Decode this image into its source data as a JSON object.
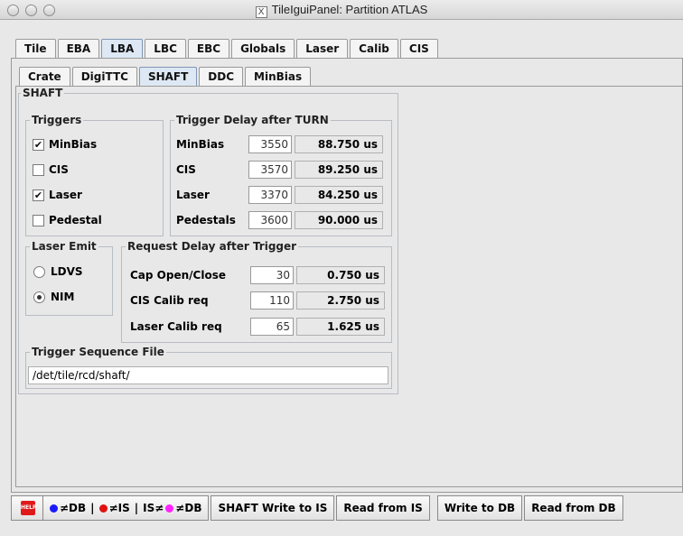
{
  "window": {
    "title": "TileIguiPanel: Partition ATLAS",
    "title_icon": "X"
  },
  "main_tabs": [
    "Tile",
    "EBA",
    "LBA",
    "LBC",
    "EBC",
    "Globals",
    "Laser",
    "Calib",
    "CIS"
  ],
  "main_tab_active": "LBA",
  "sub_tabs": [
    "Crate",
    "DigiTTC",
    "SHAFT",
    "DDC",
    "MinBias"
  ],
  "sub_tab_active": "SHAFT",
  "shaft": {
    "legend": "SHAFT",
    "triggers": {
      "legend": "Triggers",
      "items": [
        {
          "label": "MinBias",
          "checked": true,
          "mark": "✔"
        },
        {
          "label": "CIS",
          "checked": false,
          "mark": ""
        },
        {
          "label": "Laser",
          "checked": true,
          "mark": "✔"
        },
        {
          "label": "Pedestal",
          "checked": false,
          "mark": ""
        }
      ]
    },
    "trigger_delay": {
      "legend": "Trigger Delay after TURN",
      "rows": [
        {
          "label": "MinBias",
          "value": "3550",
          "time": "88.750 us"
        },
        {
          "label": "CIS",
          "value": "3570",
          "time": "89.250 us"
        },
        {
          "label": "Laser",
          "value": "3370",
          "time": "84.250 us"
        },
        {
          "label": "Pedestals",
          "value": "3600",
          "time": "90.000 us"
        }
      ]
    },
    "laser_emit": {
      "legend": "Laser Emit",
      "options": [
        {
          "label": "LDVS",
          "selected": false
        },
        {
          "label": "NIM",
          "selected": true
        }
      ]
    },
    "request_delay": {
      "legend": "Request Delay after Trigger",
      "rows": [
        {
          "label": "Cap Open/Close",
          "value": "30",
          "time": "0.750 us"
        },
        {
          "label": "CIS Calib req",
          "value": "110",
          "time": "2.750 us"
        },
        {
          "label": "Laser Calib req",
          "value": "65",
          "time": "1.625 us"
        }
      ]
    },
    "sequence_file": {
      "legend": "Trigger Sequence File",
      "value": "/det/tile/rcd/shaft/"
    }
  },
  "bottom": {
    "help_label": "HELP",
    "legend_parts": [
      "≠DB",
      "|",
      "≠IS",
      "|",
      "IS≠",
      "≠DB"
    ],
    "colors": {
      "blue": "#1a1aff",
      "red": "#e01010",
      "magenta": "#ff22ff"
    },
    "buttons": [
      "SHAFT Write to IS",
      "Read from IS",
      "Write to DB",
      "Read from DB"
    ]
  }
}
